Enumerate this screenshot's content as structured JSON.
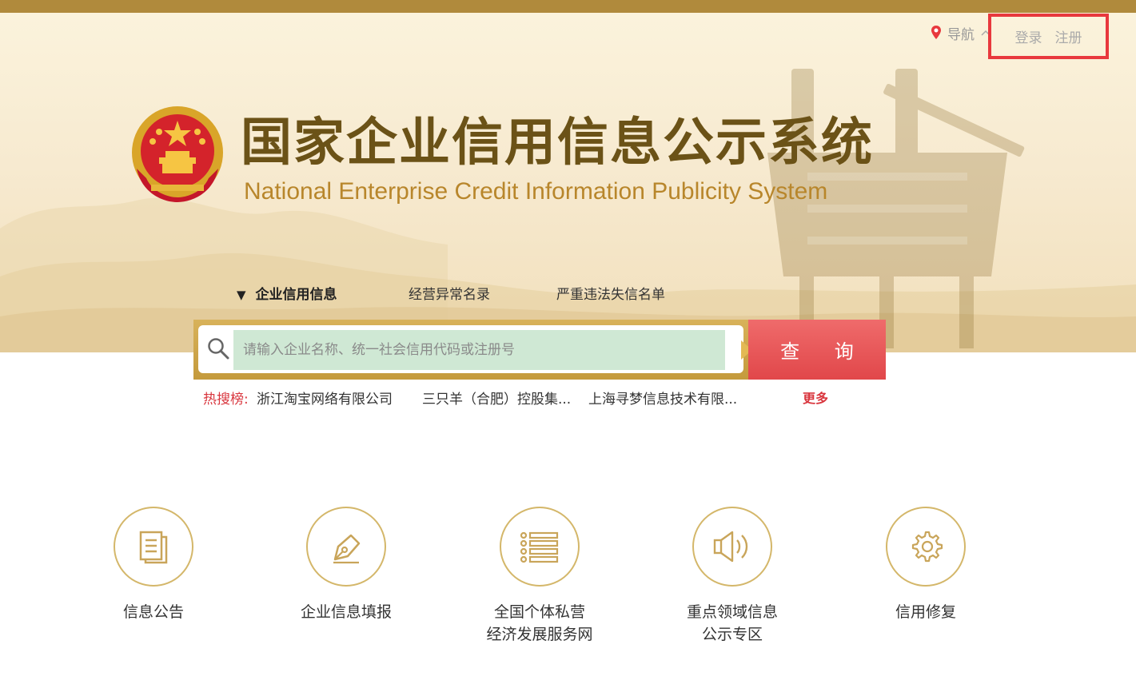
{
  "header": {
    "nav_label": "导航",
    "login_label": "登录",
    "register_label": "注册"
  },
  "brand": {
    "title_cn": "国家企业信用信息公示系统",
    "title_en": "National Enterprise Credit Information Publicity System"
  },
  "search": {
    "tabs": [
      {
        "label": "企业信用信息",
        "active": true
      },
      {
        "label": "经营异常名录",
        "active": false
      },
      {
        "label": "严重违法失信名单",
        "active": false
      }
    ],
    "active_marker": "▼",
    "placeholder": "请输入企业名称、统一社会信用代码或注册号",
    "value": "",
    "button_label": "查 询"
  },
  "hot_search": {
    "label": "热搜榜:",
    "items": [
      "浙江淘宝网络有限公司",
      "三只羊（合肥）控股集...",
      "上海寻梦信息技术有限..."
    ],
    "more_label": "更多"
  },
  "services": [
    {
      "icon": "document-icon",
      "label_lines": [
        "信息公告"
      ]
    },
    {
      "icon": "pen-icon",
      "label_lines": [
        "企业信息填报"
      ]
    },
    {
      "icon": "list-icon",
      "label_lines": [
        "全国个体私营",
        "经济发展服务网"
      ]
    },
    {
      "icon": "speaker-icon",
      "label_lines": [
        "重点领域信息",
        "公示专区"
      ]
    },
    {
      "icon": "gear-icon",
      "label_lines": [
        "信用修复"
      ]
    }
  ],
  "colors": {
    "topbar": "#b08a3c",
    "title": "#6b5217",
    "subtitle": "#b8862b",
    "accent_red": "#e1474a",
    "highlight_box": "#e8383d",
    "icon_gold": "#d4b76a"
  }
}
